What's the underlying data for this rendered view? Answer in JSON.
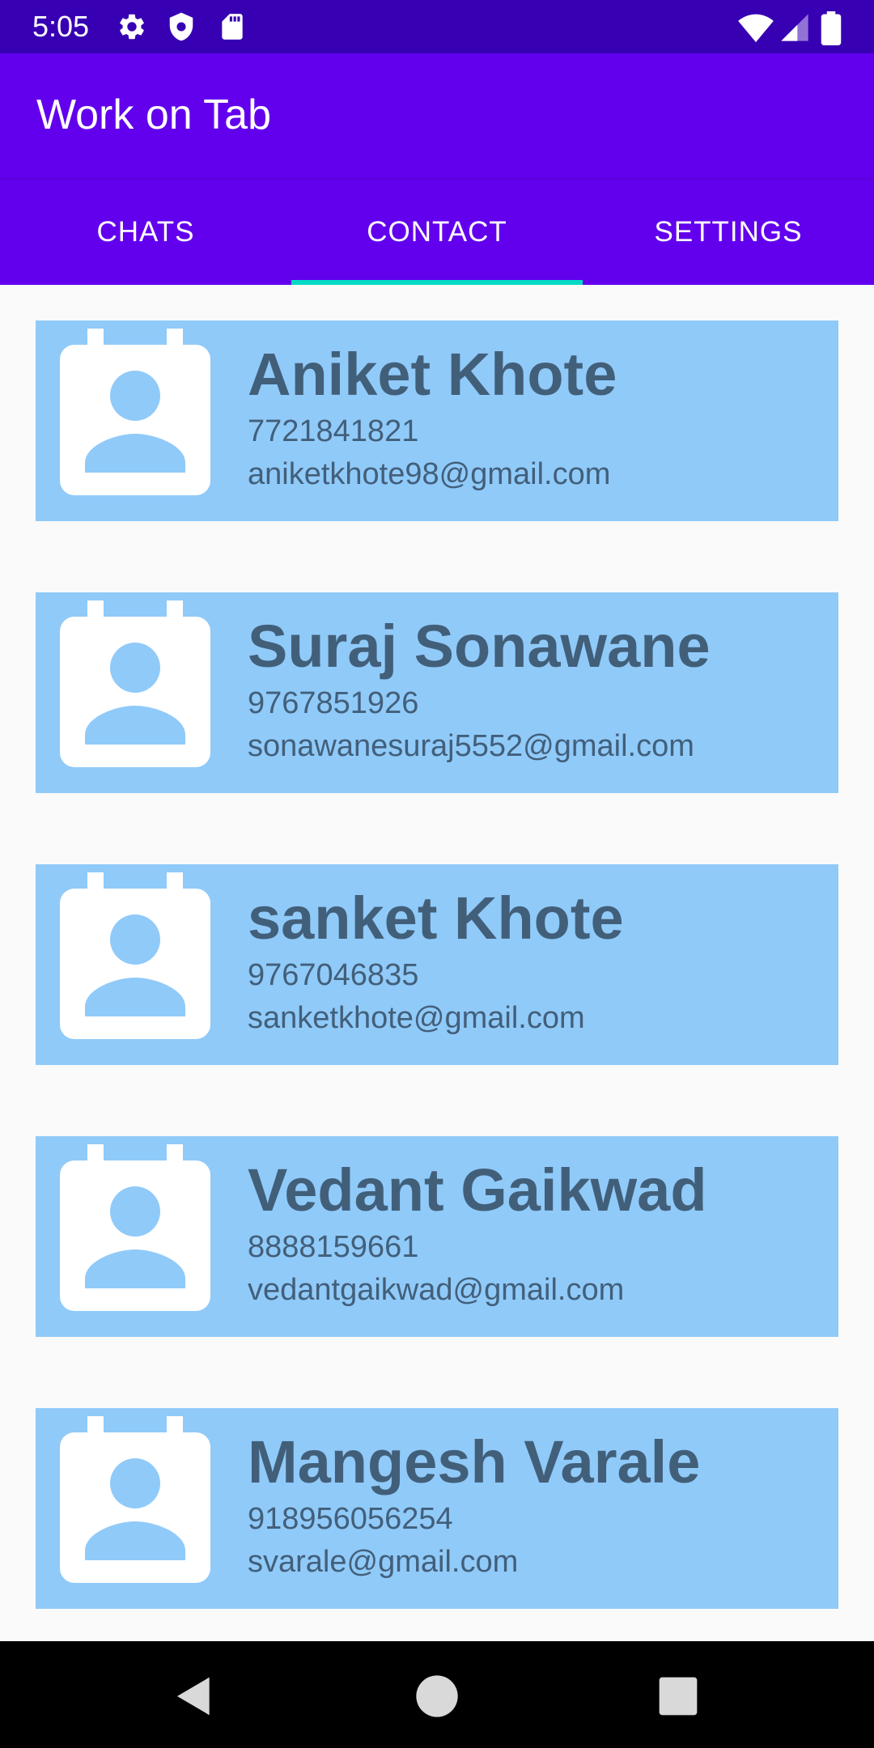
{
  "status_bar": {
    "time": "5:05",
    "left_icons": [
      "gear-icon",
      "shield-icon",
      "sd-card-icon"
    ],
    "right_icons": [
      "wifi-icon",
      "signal-icon",
      "battery-icon"
    ]
  },
  "app_bar": {
    "title": "Work on Tab"
  },
  "tabs": [
    {
      "label": "CHATS",
      "active": false
    },
    {
      "label": "CONTACT",
      "active": true
    },
    {
      "label": "SETTINGS",
      "active": false
    }
  ],
  "colors": {
    "status_bar": "#3700b3",
    "primary": "#6200ee",
    "tab_indicator": "#03dac5",
    "card_background": "#90caf9",
    "card_text": "#425f7a"
  },
  "contacts": [
    {
      "name": "Aniket Khote",
      "phone": "7721841821",
      "email": "aniketkhote98@gmail.com",
      "icon": "contact-card-icon"
    },
    {
      "name": "Suraj Sonawane",
      "phone": "9767851926",
      "email": "sonawanesuraj5552@gmail.com",
      "icon": "contact-card-icon"
    },
    {
      "name": "sanket Khote",
      "phone": "9767046835",
      "email": "sanketkhote@gmail.com",
      "icon": "contact-card-icon"
    },
    {
      "name": "Vedant Gaikwad",
      "phone": "8888159661",
      "email": "vedantgaikwad@gmail.com",
      "icon": "contact-card-icon"
    },
    {
      "name": "Mangesh Varale",
      "phone": "918956056254",
      "email": "svarale@gmail.com",
      "icon": "contact-card-icon"
    }
  ],
  "nav_bar": {
    "buttons": [
      "back-icon",
      "home-icon",
      "recents-icon"
    ]
  }
}
